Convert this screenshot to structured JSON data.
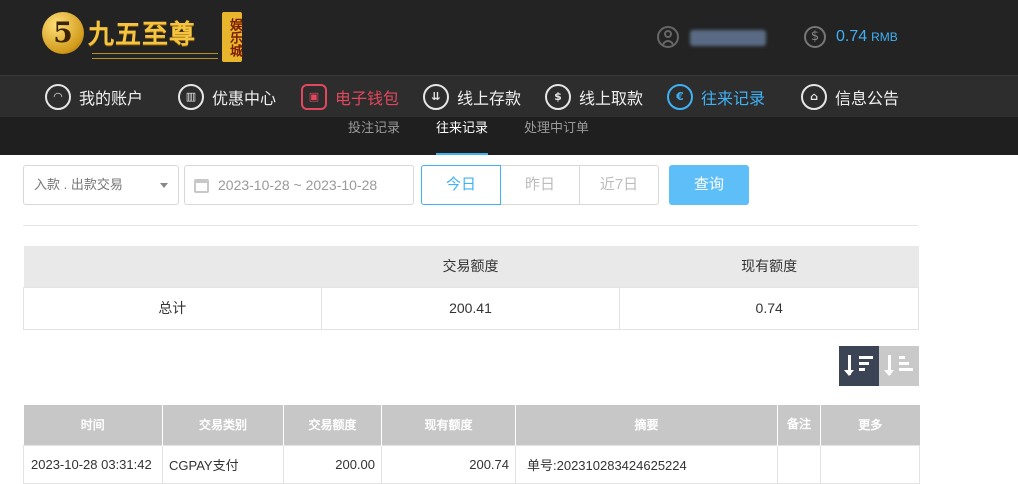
{
  "brand": {
    "logo_char": "5",
    "name": "九五至尊",
    "tag": "娱乐城"
  },
  "account": {
    "username": "",
    "balance": "0.74",
    "currency": "RMB"
  },
  "main_nav": [
    {
      "label": "我的账户",
      "icon": "user-icon"
    },
    {
      "label": "优惠中心",
      "icon": "gift-icon"
    },
    {
      "label": "电子钱包",
      "icon": "wallet-icon",
      "state": "highlight"
    },
    {
      "label": "线上存款",
      "icon": "deposit-icon"
    },
    {
      "label": "线上取款",
      "icon": "withdraw-icon"
    },
    {
      "label": "往来记录",
      "icon": "records-icon",
      "state": "active"
    },
    {
      "label": "信息公告",
      "icon": "bell-icon"
    }
  ],
  "sub_nav": [
    {
      "label": "投注记录"
    },
    {
      "label": "往来记录",
      "active": true
    },
    {
      "label": "处理中订单"
    }
  ],
  "filters": {
    "type_select": "入款 . 出款交易",
    "date_range": "2023-10-28 ~ 2023-10-28",
    "quick": [
      "今日",
      "昨日",
      "近7日"
    ],
    "active_quick": "今日",
    "search_label": "查询"
  },
  "summary": {
    "headers": [
      "",
      "交易额度",
      "现有额度"
    ],
    "row": [
      "总计",
      "200.41",
      "0.74"
    ]
  },
  "records": {
    "headers": [
      "时间",
      "交易类别",
      "交易额度",
      "现有额度",
      "摘要",
      "备注",
      "更多"
    ],
    "rows": [
      [
        "2023-10-28 03:31:42",
        "CGPAY支付",
        "200.00",
        "200.74",
        "单号:202310283424625224",
        "",
        ""
      ]
    ]
  },
  "colors": {
    "accent": "#3fb1f5",
    "highlight": "#e2475d",
    "header_bg": "#232323"
  }
}
